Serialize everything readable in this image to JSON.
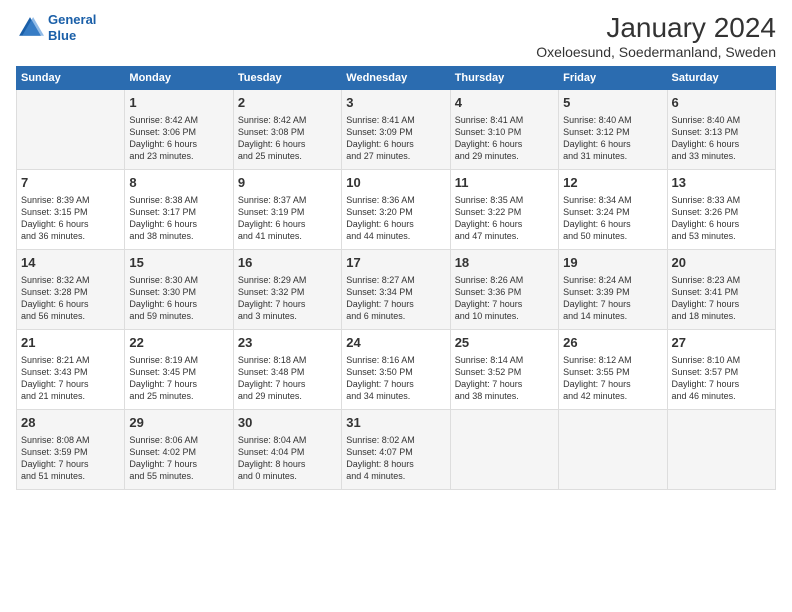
{
  "header": {
    "logo_line1": "General",
    "logo_line2": "Blue",
    "main_title": "January 2024",
    "subtitle": "Oxeloesund, Soedermanland, Sweden"
  },
  "days_of_week": [
    "Sunday",
    "Monday",
    "Tuesday",
    "Wednesday",
    "Thursday",
    "Friday",
    "Saturday"
  ],
  "weeks": [
    [
      {
        "day": "",
        "info": ""
      },
      {
        "day": "1",
        "info": "Sunrise: 8:42 AM\nSunset: 3:06 PM\nDaylight: 6 hours\nand 23 minutes."
      },
      {
        "day": "2",
        "info": "Sunrise: 8:42 AM\nSunset: 3:08 PM\nDaylight: 6 hours\nand 25 minutes."
      },
      {
        "day": "3",
        "info": "Sunrise: 8:41 AM\nSunset: 3:09 PM\nDaylight: 6 hours\nand 27 minutes."
      },
      {
        "day": "4",
        "info": "Sunrise: 8:41 AM\nSunset: 3:10 PM\nDaylight: 6 hours\nand 29 minutes."
      },
      {
        "day": "5",
        "info": "Sunrise: 8:40 AM\nSunset: 3:12 PM\nDaylight: 6 hours\nand 31 minutes."
      },
      {
        "day": "6",
        "info": "Sunrise: 8:40 AM\nSunset: 3:13 PM\nDaylight: 6 hours\nand 33 minutes."
      }
    ],
    [
      {
        "day": "7",
        "info": "Sunrise: 8:39 AM\nSunset: 3:15 PM\nDaylight: 6 hours\nand 36 minutes."
      },
      {
        "day": "8",
        "info": "Sunrise: 8:38 AM\nSunset: 3:17 PM\nDaylight: 6 hours\nand 38 minutes."
      },
      {
        "day": "9",
        "info": "Sunrise: 8:37 AM\nSunset: 3:19 PM\nDaylight: 6 hours\nand 41 minutes."
      },
      {
        "day": "10",
        "info": "Sunrise: 8:36 AM\nSunset: 3:20 PM\nDaylight: 6 hours\nand 44 minutes."
      },
      {
        "day": "11",
        "info": "Sunrise: 8:35 AM\nSunset: 3:22 PM\nDaylight: 6 hours\nand 47 minutes."
      },
      {
        "day": "12",
        "info": "Sunrise: 8:34 AM\nSunset: 3:24 PM\nDaylight: 6 hours\nand 50 minutes."
      },
      {
        "day": "13",
        "info": "Sunrise: 8:33 AM\nSunset: 3:26 PM\nDaylight: 6 hours\nand 53 minutes."
      }
    ],
    [
      {
        "day": "14",
        "info": "Sunrise: 8:32 AM\nSunset: 3:28 PM\nDaylight: 6 hours\nand 56 minutes."
      },
      {
        "day": "15",
        "info": "Sunrise: 8:30 AM\nSunset: 3:30 PM\nDaylight: 6 hours\nand 59 minutes."
      },
      {
        "day": "16",
        "info": "Sunrise: 8:29 AM\nSunset: 3:32 PM\nDaylight: 7 hours\nand 3 minutes."
      },
      {
        "day": "17",
        "info": "Sunrise: 8:27 AM\nSunset: 3:34 PM\nDaylight: 7 hours\nand 6 minutes."
      },
      {
        "day": "18",
        "info": "Sunrise: 8:26 AM\nSunset: 3:36 PM\nDaylight: 7 hours\nand 10 minutes."
      },
      {
        "day": "19",
        "info": "Sunrise: 8:24 AM\nSunset: 3:39 PM\nDaylight: 7 hours\nand 14 minutes."
      },
      {
        "day": "20",
        "info": "Sunrise: 8:23 AM\nSunset: 3:41 PM\nDaylight: 7 hours\nand 18 minutes."
      }
    ],
    [
      {
        "day": "21",
        "info": "Sunrise: 8:21 AM\nSunset: 3:43 PM\nDaylight: 7 hours\nand 21 minutes."
      },
      {
        "day": "22",
        "info": "Sunrise: 8:19 AM\nSunset: 3:45 PM\nDaylight: 7 hours\nand 25 minutes."
      },
      {
        "day": "23",
        "info": "Sunrise: 8:18 AM\nSunset: 3:48 PM\nDaylight: 7 hours\nand 29 minutes."
      },
      {
        "day": "24",
        "info": "Sunrise: 8:16 AM\nSunset: 3:50 PM\nDaylight: 7 hours\nand 34 minutes."
      },
      {
        "day": "25",
        "info": "Sunrise: 8:14 AM\nSunset: 3:52 PM\nDaylight: 7 hours\nand 38 minutes."
      },
      {
        "day": "26",
        "info": "Sunrise: 8:12 AM\nSunset: 3:55 PM\nDaylight: 7 hours\nand 42 minutes."
      },
      {
        "day": "27",
        "info": "Sunrise: 8:10 AM\nSunset: 3:57 PM\nDaylight: 7 hours\nand 46 minutes."
      }
    ],
    [
      {
        "day": "28",
        "info": "Sunrise: 8:08 AM\nSunset: 3:59 PM\nDaylight: 7 hours\nand 51 minutes."
      },
      {
        "day": "29",
        "info": "Sunrise: 8:06 AM\nSunset: 4:02 PM\nDaylight: 7 hours\nand 55 minutes."
      },
      {
        "day": "30",
        "info": "Sunrise: 8:04 AM\nSunset: 4:04 PM\nDaylight: 8 hours\nand 0 minutes."
      },
      {
        "day": "31",
        "info": "Sunrise: 8:02 AM\nSunset: 4:07 PM\nDaylight: 8 hours\nand 4 minutes."
      },
      {
        "day": "",
        "info": ""
      },
      {
        "day": "",
        "info": ""
      },
      {
        "day": "",
        "info": ""
      }
    ]
  ]
}
